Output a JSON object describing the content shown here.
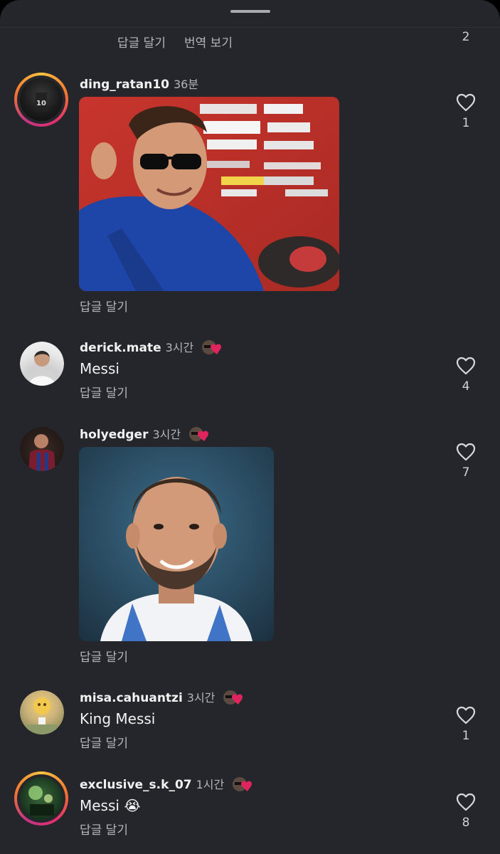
{
  "header": {
    "reply_label": "답글 달기",
    "translate_label": "번역 보기",
    "like_count": "2"
  },
  "comments": [
    {
      "username": "ding_ratan10",
      "time": "36분",
      "text": "",
      "reply_label": "답글 달기",
      "like_count": "1",
      "has_media": true,
      "has_creator_badge": false,
      "has_story_ring": true
    },
    {
      "username": "derick.mate",
      "time": "3시간",
      "text": "Messi",
      "reply_label": "답글 달기",
      "like_count": "4",
      "has_media": false,
      "has_creator_badge": true,
      "has_story_ring": false
    },
    {
      "username": "holyedger",
      "time": "3시간",
      "text": "",
      "reply_label": "답글 달기",
      "like_count": "7",
      "has_media": true,
      "has_creator_badge": true,
      "has_story_ring": false
    },
    {
      "username": "misa.cahuantzi",
      "time": "3시간",
      "text": "King Messi",
      "reply_label": "답글 달기",
      "like_count": "1",
      "has_media": false,
      "has_creator_badge": true,
      "has_story_ring": false
    },
    {
      "username": "exclusive_s.k_07",
      "time": "1시간",
      "text": "Messi 😭",
      "reply_label": "답글 달기",
      "like_count": "8",
      "has_media": false,
      "has_creator_badge": true,
      "has_story_ring": true
    }
  ],
  "colors": {
    "background": "#25262b",
    "text_primary": "#f2f2f2",
    "text_secondary": "#b3b5ba",
    "like_heart_badge": "#e0245e"
  },
  "icons": {
    "like": "heart-outline-icon",
    "creator_like": "creator-liked-badge-icon"
  }
}
